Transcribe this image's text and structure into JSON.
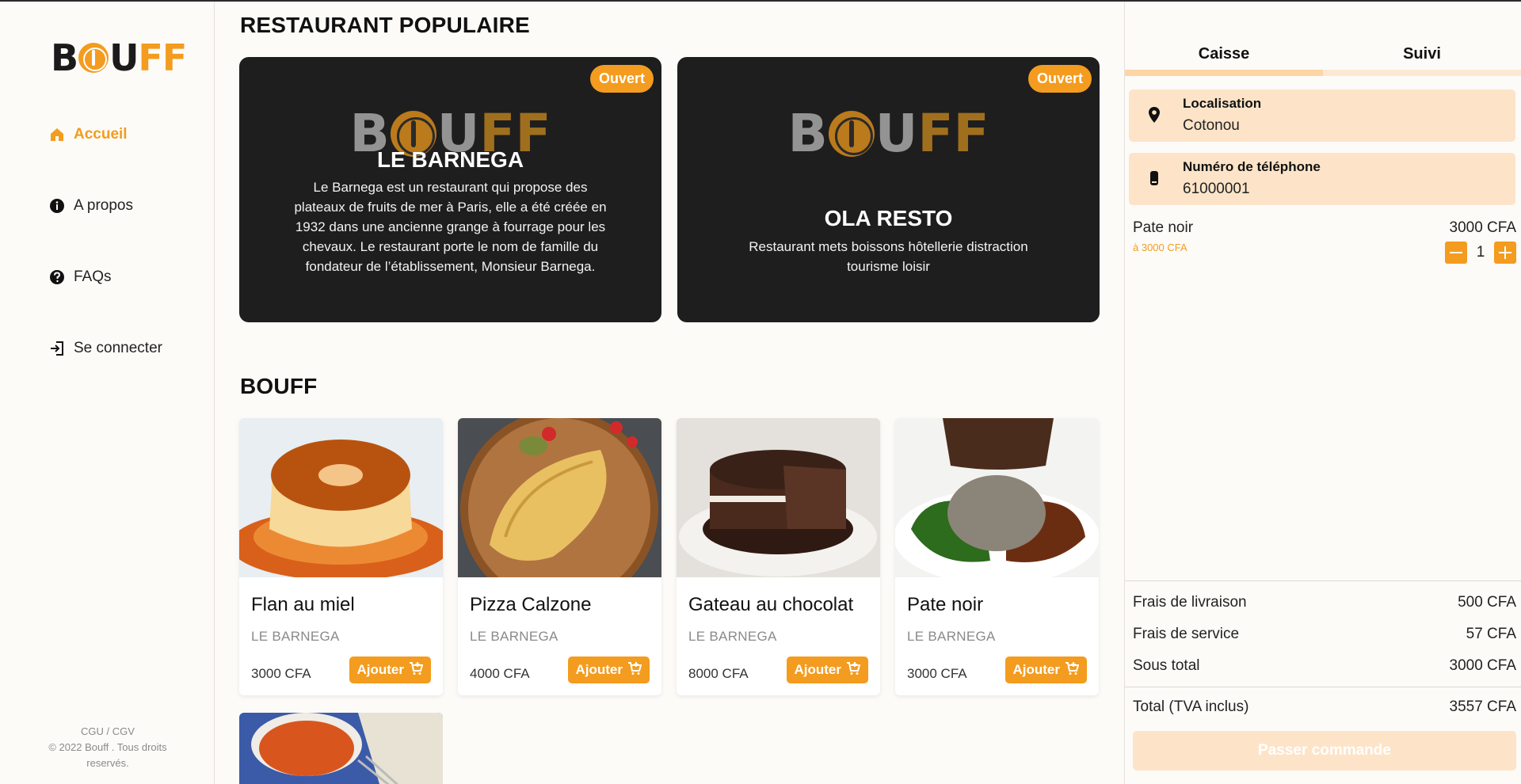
{
  "brand": {
    "logo_b": "B",
    "logo_u": "U",
    "logo_ff": "FF"
  },
  "sidebar": {
    "items": [
      {
        "label": "Accueil",
        "icon": "home-icon",
        "active": true
      },
      {
        "label": "A propos",
        "icon": "info-icon",
        "active": false
      },
      {
        "label": "FAQs",
        "icon": "question-icon",
        "active": false
      },
      {
        "label": "Se connecter",
        "icon": "login-icon",
        "active": false
      }
    ],
    "footer_links": "CGU / CGV",
    "copyright": "© 2022 Bouff . Tous droits reservés."
  },
  "main": {
    "popular_title": "RESTAURANT POPULAIRE",
    "restaurants": [
      {
        "name": "LE BARNEGA",
        "status": "Ouvert",
        "description": "Le Barnega est un restaurant qui propose des plateaux de fruits de mer à Paris, elle a été créée en 1932 dans une ancienne grange à fourrage pour les chevaux. Le restaurant porte le nom de famille du fondateur de l’établissement, Monsieur Barnega."
      },
      {
        "name": "OLA RESTO",
        "status": "Ouvert",
        "description": "Restaurant mets boissons hôtellerie distraction tourisme loisir"
      }
    ],
    "menu_title": "BOUFF",
    "foods": [
      {
        "name": "Flan au miel",
        "restaurant": "LE BARNEGA",
        "price": "3000 CFA",
        "add_label": "Ajouter"
      },
      {
        "name": "Pizza Calzone",
        "restaurant": "LE BARNEGA",
        "price": "4000 CFA",
        "add_label": "Ajouter"
      },
      {
        "name": "Gateau au chocolat",
        "restaurant": "LE BARNEGA",
        "price": "8000 CFA",
        "add_label": "Ajouter"
      },
      {
        "name": "Pate noir",
        "restaurant": "LE BARNEGA",
        "price": "3000 CFA",
        "add_label": "Ajouter"
      }
    ]
  },
  "cart": {
    "tabs": [
      {
        "label": "Caisse",
        "active": true
      },
      {
        "label": "Suivi",
        "active": false
      }
    ],
    "location_label": "Localisation",
    "location_value": "Cotonou",
    "phone_label": "Numéro de téléphone",
    "phone_value": "61000001",
    "item": {
      "name": "Pate noir",
      "unit_price": "à 3000 CFA",
      "price": "3000 CFA",
      "quantity": "1"
    },
    "delivery_label": "Frais de livraison",
    "delivery_value": "500 CFA",
    "service_label": "Frais de service",
    "service_value": "57 CFA",
    "subtotal_label": "Sous total",
    "subtotal_value": "3000 CFA",
    "total_label": "Total (TVA inclus)",
    "total_value": "3557 CFA",
    "order_label": "Passer commande"
  },
  "colors": {
    "accent": "#f39c1f",
    "accent_light": "#fde4c8",
    "card_dark": "#1e1e1e"
  }
}
